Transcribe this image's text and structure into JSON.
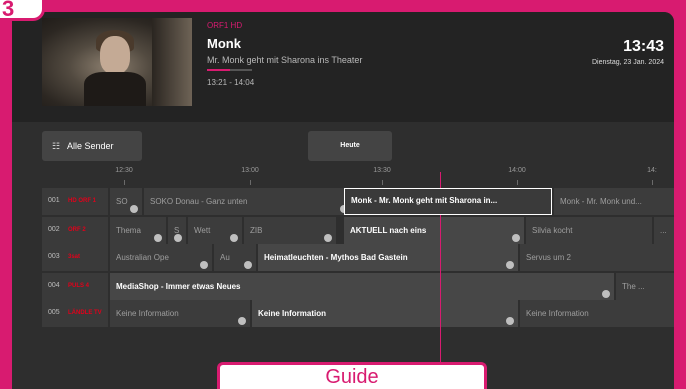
{
  "corner_badge": "3",
  "now_playing": {
    "channel": "ORF1 HD",
    "title": "Monk",
    "subtitle": "Mr. Monk geht mit Sharona ins Theater",
    "time": "13:21 - 14:04",
    "progress": 0.52
  },
  "clock": {
    "time": "13:43",
    "date": "Dienstag, 23 Jan. 2024"
  },
  "controls": {
    "all_channels": "Alle Sender",
    "today": "Heute"
  },
  "timeline": [
    "12:30",
    "13:00",
    "13:30",
    "14:00",
    "14:"
  ],
  "rows": [
    {
      "num": "001",
      "logo": "HD ORF 1",
      "logo_color": "#e2001a",
      "programs": [
        {
          "title": "SO",
          "dim": true
        },
        {
          "title": "SOKO Donau - Ganz unten",
          "dim": true
        },
        {
          "title": "Monk - Mr. Monk geht mit Sharona in...",
          "focused": true
        },
        {
          "title": "Monk - Mr. Monk und...",
          "dim": true
        }
      ]
    },
    {
      "num": "002",
      "logo": "ORF 2",
      "logo_color": "#e2001a",
      "programs": [
        {
          "title": "Thema",
          "dim": true
        },
        {
          "title": "S",
          "dim": true
        },
        {
          "title": "Wett",
          "dim": true
        },
        {
          "title": "ZIB",
          "dim": true
        },
        {
          "title": "AKTUELL nach eins",
          "bright": true
        },
        {
          "title": "Silvia kocht",
          "dim": true
        },
        {
          "title": "...",
          "dim": true
        }
      ]
    },
    {
      "num": "003",
      "logo": "3sat",
      "logo_color": "#e2001a",
      "programs": [
        {
          "title": "Australian Ope",
          "dim": true
        },
        {
          "title": "Au",
          "dim": true
        },
        {
          "title": "Heimatleuchten - Mythos Bad Gastein",
          "bright": true
        },
        {
          "title": "Servus um 2",
          "dim": true
        }
      ]
    },
    {
      "num": "004",
      "logo": "PULS 4",
      "logo_color": "#e2001a",
      "programs": [
        {
          "title": "MediaShop - Immer etwas Neues",
          "bright": true
        },
        {
          "title": "The ...",
          "dim": true
        }
      ]
    },
    {
      "num": "005",
      "logo": "LÄNDLE TV",
      "logo_color": "#e2001a",
      "programs": [
        {
          "title": "Keine Information",
          "dim": true
        },
        {
          "title": "Keine Information",
          "bright": true
        },
        {
          "title": "Keine Information",
          "dim": true
        }
      ]
    }
  ],
  "guide_tab": "Guide"
}
